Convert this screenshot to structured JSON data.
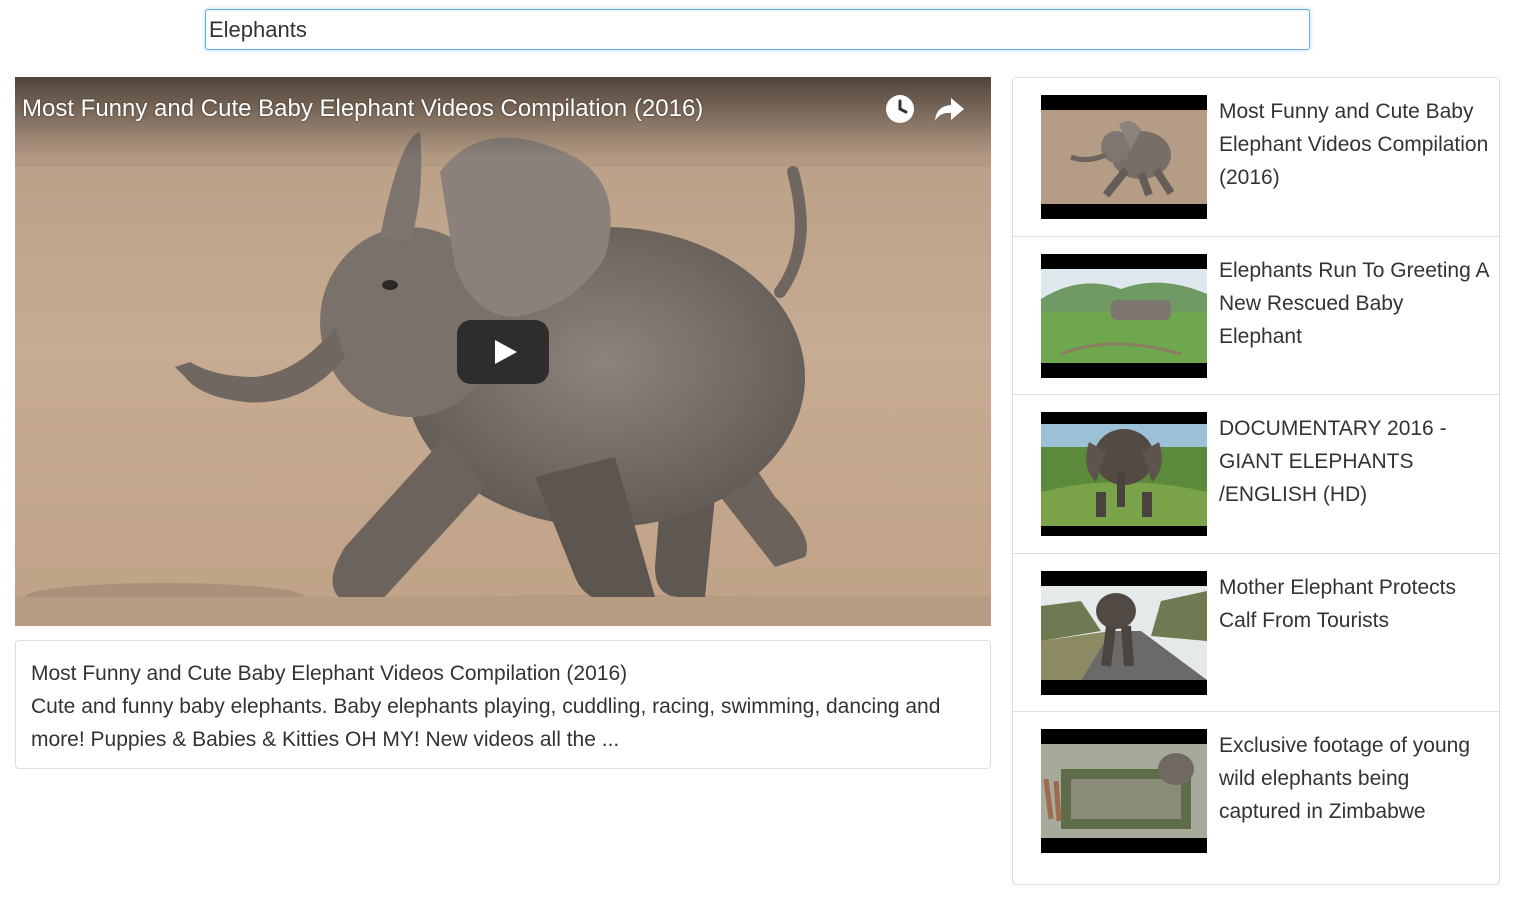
{
  "search": {
    "value": "Elephants"
  },
  "player": {
    "title": "Most Funny and Cute Baby Elephant Videos Compilation (2016)",
    "icons": [
      "clock-icon",
      "share-icon",
      "play-icon"
    ]
  },
  "detail": {
    "title": "Most Funny and Cute Baby Elephant Videos Compilation (2016)",
    "description": "Cute and funny baby elephants. Baby elephants playing, cuddling, racing, swimming, dancing and more! Puppies & Babies & Kitties OH MY! New videos all the ..."
  },
  "video_list": [
    {
      "title": "Most Funny and Cute Baby Elephant Videos Compilation (2016)"
    },
    {
      "title": "Elephants Run To Greeting A New Rescued Baby Elephant"
    },
    {
      "title": "DOCUMENTARY 2016 - GIANT ELEPHANTS /ENGLISH (HD)"
    },
    {
      "title": "Mother Elephant Protects Calf From Tourists"
    },
    {
      "title": "Exclusive footage of young wild elephants being captured in Zimbabwe"
    }
  ]
}
